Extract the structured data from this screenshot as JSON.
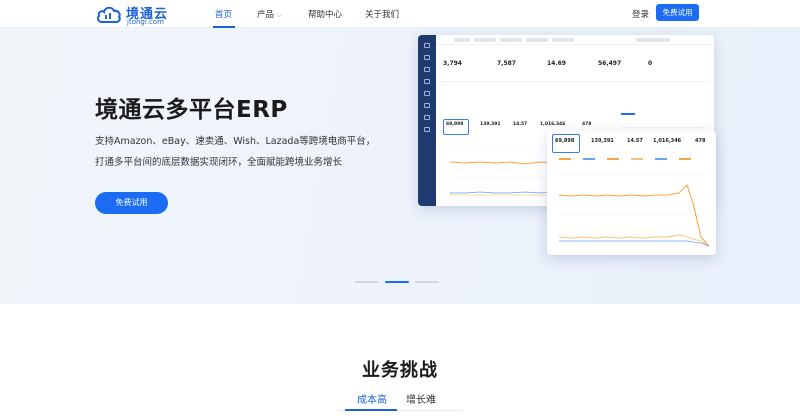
{
  "header": {
    "logo_name": "境通云",
    "logo_domain": "jtongi.com",
    "nav": [
      {
        "label": "首页",
        "active": true
      },
      {
        "label": "产品",
        "has_dropdown": true
      },
      {
        "label": "帮助中心"
      },
      {
        "label": "关于我们"
      }
    ],
    "login_label": "登录",
    "trial_label": "免费试用"
  },
  "hero": {
    "title": "境通云多平台ERP",
    "subtitle_line1": "支持Amazon、eBay、速卖通、Wish、Lazada等跨境电商平台，",
    "subtitle_line2": "打通多平台间的底层数据实现闭环，全面赋能跨境业务增长",
    "cta_label": "免费试用",
    "carousel": {
      "count": 3,
      "active_index": 1
    }
  },
  "dashboard": {
    "kpis": [
      {
        "value": "3,794"
      },
      {
        "value": "7,587"
      },
      {
        "value": "14.69"
      },
      {
        "value": "56,497"
      },
      {
        "value": "0"
      }
    ],
    "kpis_row2": [
      {
        "value": "69,898"
      },
      {
        "value": "139,391"
      },
      {
        "value": "14.57"
      },
      {
        "value": "1,016,346"
      },
      {
        "value": "478"
      }
    ],
    "popup_kpis": [
      {
        "value": "69,898"
      },
      {
        "value": "139,391"
      },
      {
        "value": "14.57"
      },
      {
        "value": "1,016,346"
      },
      {
        "value": "478"
      }
    ],
    "colors": {
      "sidebar": "#1e3a6e",
      "line_orange": "#f5a64a",
      "line_blue": "#6aa3f0",
      "accent": "#1b6cf2"
    }
  },
  "challenges": {
    "title": "业务挑战",
    "tabs": [
      {
        "label": "成本高",
        "active": true
      },
      {
        "label": "增长难"
      }
    ]
  }
}
